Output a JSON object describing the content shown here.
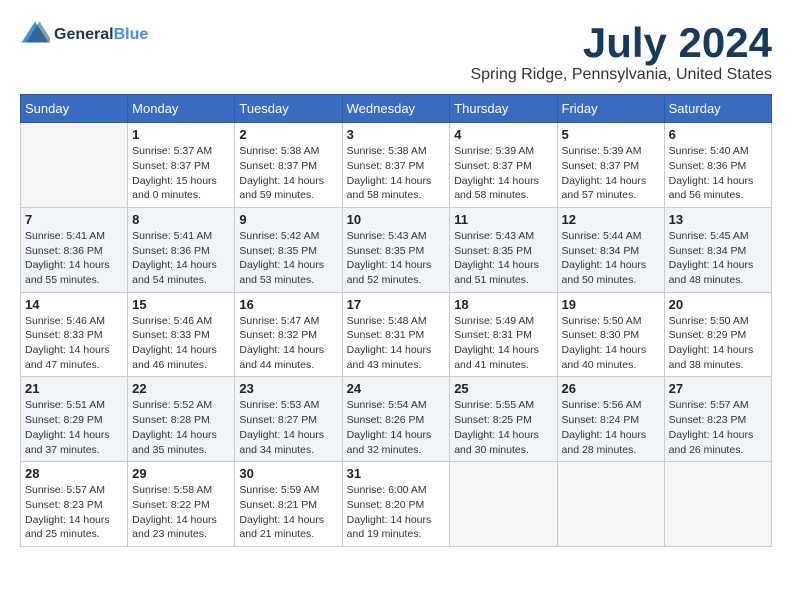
{
  "logo": {
    "line1": "General",
    "line2": "Blue"
  },
  "title": "July 2024",
  "location": "Spring Ridge, Pennsylvania, United States",
  "weekdays": [
    "Sunday",
    "Monday",
    "Tuesday",
    "Wednesday",
    "Thursday",
    "Friday",
    "Saturday"
  ],
  "weeks": [
    [
      {
        "day": "",
        "info": ""
      },
      {
        "day": "1",
        "info": "Sunrise: 5:37 AM\nSunset: 8:37 PM\nDaylight: 15 hours\nand 0 minutes."
      },
      {
        "day": "2",
        "info": "Sunrise: 5:38 AM\nSunset: 8:37 PM\nDaylight: 14 hours\nand 59 minutes."
      },
      {
        "day": "3",
        "info": "Sunrise: 5:38 AM\nSunset: 8:37 PM\nDaylight: 14 hours\nand 58 minutes."
      },
      {
        "day": "4",
        "info": "Sunrise: 5:39 AM\nSunset: 8:37 PM\nDaylight: 14 hours\nand 58 minutes."
      },
      {
        "day": "5",
        "info": "Sunrise: 5:39 AM\nSunset: 8:37 PM\nDaylight: 14 hours\nand 57 minutes."
      },
      {
        "day": "6",
        "info": "Sunrise: 5:40 AM\nSunset: 8:36 PM\nDaylight: 14 hours\nand 56 minutes."
      }
    ],
    [
      {
        "day": "7",
        "info": "Sunrise: 5:41 AM\nSunset: 8:36 PM\nDaylight: 14 hours\nand 55 minutes."
      },
      {
        "day": "8",
        "info": "Sunrise: 5:41 AM\nSunset: 8:36 PM\nDaylight: 14 hours\nand 54 minutes."
      },
      {
        "day": "9",
        "info": "Sunrise: 5:42 AM\nSunset: 8:35 PM\nDaylight: 14 hours\nand 53 minutes."
      },
      {
        "day": "10",
        "info": "Sunrise: 5:43 AM\nSunset: 8:35 PM\nDaylight: 14 hours\nand 52 minutes."
      },
      {
        "day": "11",
        "info": "Sunrise: 5:43 AM\nSunset: 8:35 PM\nDaylight: 14 hours\nand 51 minutes."
      },
      {
        "day": "12",
        "info": "Sunrise: 5:44 AM\nSunset: 8:34 PM\nDaylight: 14 hours\nand 50 minutes."
      },
      {
        "day": "13",
        "info": "Sunrise: 5:45 AM\nSunset: 8:34 PM\nDaylight: 14 hours\nand 48 minutes."
      }
    ],
    [
      {
        "day": "14",
        "info": "Sunrise: 5:46 AM\nSunset: 8:33 PM\nDaylight: 14 hours\nand 47 minutes."
      },
      {
        "day": "15",
        "info": "Sunrise: 5:46 AM\nSunset: 8:33 PM\nDaylight: 14 hours\nand 46 minutes."
      },
      {
        "day": "16",
        "info": "Sunrise: 5:47 AM\nSunset: 8:32 PM\nDaylight: 14 hours\nand 44 minutes."
      },
      {
        "day": "17",
        "info": "Sunrise: 5:48 AM\nSunset: 8:31 PM\nDaylight: 14 hours\nand 43 minutes."
      },
      {
        "day": "18",
        "info": "Sunrise: 5:49 AM\nSunset: 8:31 PM\nDaylight: 14 hours\nand 41 minutes."
      },
      {
        "day": "19",
        "info": "Sunrise: 5:50 AM\nSunset: 8:30 PM\nDaylight: 14 hours\nand 40 minutes."
      },
      {
        "day": "20",
        "info": "Sunrise: 5:50 AM\nSunset: 8:29 PM\nDaylight: 14 hours\nand 38 minutes."
      }
    ],
    [
      {
        "day": "21",
        "info": "Sunrise: 5:51 AM\nSunset: 8:29 PM\nDaylight: 14 hours\nand 37 minutes."
      },
      {
        "day": "22",
        "info": "Sunrise: 5:52 AM\nSunset: 8:28 PM\nDaylight: 14 hours\nand 35 minutes."
      },
      {
        "day": "23",
        "info": "Sunrise: 5:53 AM\nSunset: 8:27 PM\nDaylight: 14 hours\nand 34 minutes."
      },
      {
        "day": "24",
        "info": "Sunrise: 5:54 AM\nSunset: 8:26 PM\nDaylight: 14 hours\nand 32 minutes."
      },
      {
        "day": "25",
        "info": "Sunrise: 5:55 AM\nSunset: 8:25 PM\nDaylight: 14 hours\nand 30 minutes."
      },
      {
        "day": "26",
        "info": "Sunrise: 5:56 AM\nSunset: 8:24 PM\nDaylight: 14 hours\nand 28 minutes."
      },
      {
        "day": "27",
        "info": "Sunrise: 5:57 AM\nSunset: 8:23 PM\nDaylight: 14 hours\nand 26 minutes."
      }
    ],
    [
      {
        "day": "28",
        "info": "Sunrise: 5:57 AM\nSunset: 8:23 PM\nDaylight: 14 hours\nand 25 minutes."
      },
      {
        "day": "29",
        "info": "Sunrise: 5:58 AM\nSunset: 8:22 PM\nDaylight: 14 hours\nand 23 minutes."
      },
      {
        "day": "30",
        "info": "Sunrise: 5:59 AM\nSunset: 8:21 PM\nDaylight: 14 hours\nand 21 minutes."
      },
      {
        "day": "31",
        "info": "Sunrise: 6:00 AM\nSunset: 8:20 PM\nDaylight: 14 hours\nand 19 minutes."
      },
      {
        "day": "",
        "info": ""
      },
      {
        "day": "",
        "info": ""
      },
      {
        "day": "",
        "info": ""
      }
    ]
  ]
}
